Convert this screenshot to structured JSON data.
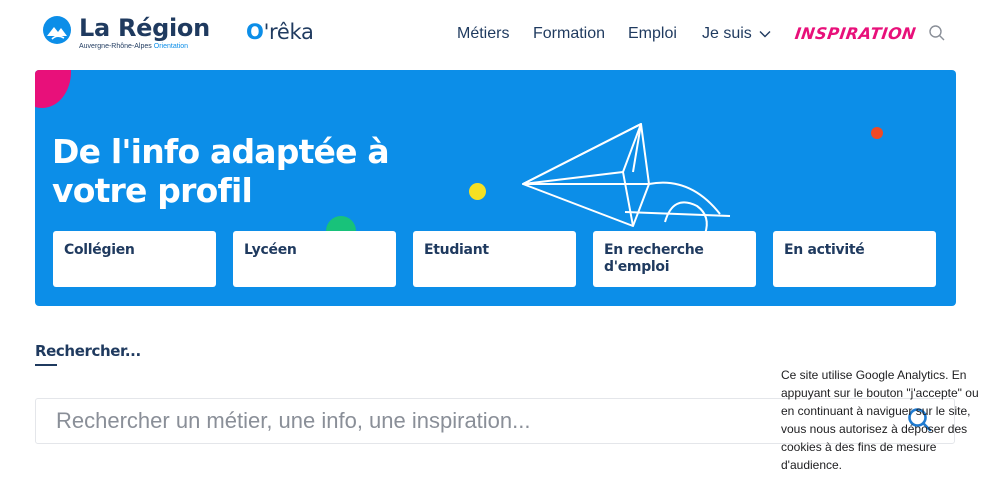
{
  "header": {
    "logo_title": "La Région",
    "logo_subtitle": "Auvergne-Rhône-Alpes",
    "logo_subtitle_accent": "Orientation",
    "brand_prefix": "O",
    "brand_rest": "'rêka",
    "nav": {
      "metiers": "Métiers",
      "formation": "Formation",
      "emploi": "Emploi",
      "je_suis": "Je suis",
      "inspiration": "INSPIRATION"
    }
  },
  "hero": {
    "title": "De l'info adaptée à votre profil",
    "profiles": [
      "Collégien",
      "Lycéen",
      "Etudiant",
      "En recherche d'emploi",
      "En activité"
    ]
  },
  "search": {
    "heading": "Rechercher...",
    "placeholder": "Rechercher un métier, une info, une inspiration..."
  },
  "cookie_notice": {
    "text": "Ce site utilise Google Analytics. En appuyant sur le bouton \"j'accepte\" ou en continuant à naviguer sur le site, vous nous autorisez à déposer des cookies à des fins de mesure d'audience."
  },
  "colors": {
    "brand_blue": "#0c8ee8",
    "navy": "#1f3a5f",
    "pink": "#e8107a",
    "yellow": "#f5e023",
    "red": "#ef4a26",
    "green": "#18c27a"
  },
  "icons": {
    "logo": "region-logo-icon",
    "search": "search-icon",
    "chevron": "chevron-down-icon",
    "plane": "paper-plane-icon"
  }
}
